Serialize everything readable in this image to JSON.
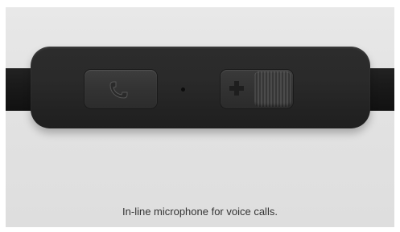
{
  "caption": "In-line microphone for voice calls.",
  "icons": {
    "call": "phone-icon",
    "volume": "plus-icon"
  },
  "colors": {
    "background": "#e2e2e2",
    "remote": "#2a2a2a",
    "caption_text": "#333333"
  }
}
